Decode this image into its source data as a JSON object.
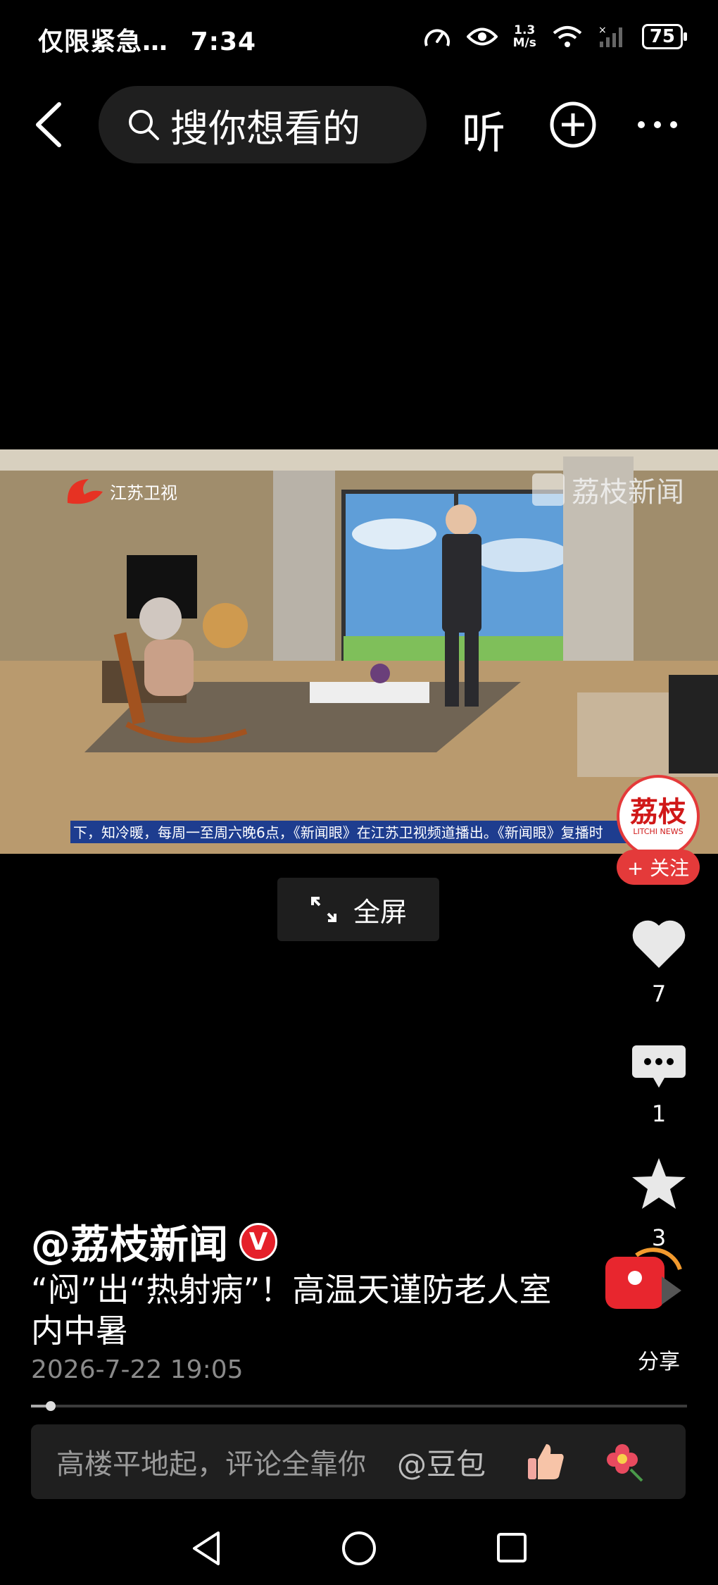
{
  "status_bar": {
    "notification": "仅限紧急…",
    "time": "7:34",
    "net_speed_value": "1.3",
    "net_speed_unit": "M/s",
    "battery": "75"
  },
  "top_nav": {
    "search_placeholder": "搜你想看的",
    "listen_label": "听"
  },
  "video": {
    "channel_logo_text": "江苏卫视",
    "watermark": "荔枝新闻",
    "ticker": "下，知冷暖，每周一至周六晚6点，《新闻眼》在江苏卫视频道播出。《新闻眼》复播时",
    "fullscreen_label": "全屏"
  },
  "right_rail": {
    "avatar_text": "荔枝",
    "avatar_sub": "LITCHI NEWS",
    "follow_label": "+ 关注",
    "likes": "7",
    "comments": "1",
    "favorites": "3",
    "share_label": "分享"
  },
  "post": {
    "author": "@荔枝新闻",
    "verified_badge": "V",
    "title": "“闷”出“热射病”！高温天谨防老人室内中暑",
    "date": "2026-7-22 19:05",
    "progress": 0.03
  },
  "comment_bar": {
    "placeholder": "高楼平地起，评论全靠你",
    "mention": "@豆包"
  },
  "colors": {
    "accent_red": "#e43a3a",
    "background": "#000000",
    "ticker_blue": "#1e3d8f"
  }
}
